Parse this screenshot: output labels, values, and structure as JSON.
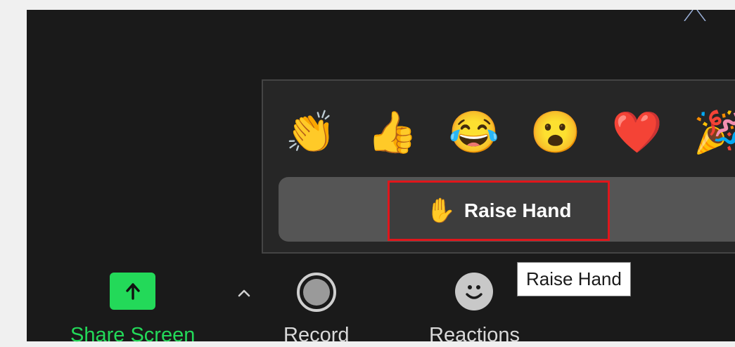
{
  "reactions_panel": {
    "emojis": [
      {
        "name": "clapping-hands",
        "glyph": "👏"
      },
      {
        "name": "thumbs-up",
        "glyph": "👍"
      },
      {
        "name": "tears-of-joy",
        "glyph": "😂"
      },
      {
        "name": "open-mouth",
        "glyph": "😮"
      },
      {
        "name": "red-heart",
        "glyph": "❤️"
      },
      {
        "name": "party-popper",
        "glyph": "🎉"
      }
    ],
    "raise_hand": {
      "icon": "raised-hand-icon",
      "glyph": "✋",
      "label": "Raise Hand"
    }
  },
  "tooltip": {
    "text": "Raise Hand"
  },
  "toolbar": {
    "share_screen": {
      "label": "Share Screen",
      "icon": "share-screen-arrow-up-icon"
    },
    "caret": {
      "icon": "chevron-up-icon"
    },
    "record": {
      "label": "Record",
      "icon": "record-icon"
    },
    "reactions": {
      "label": "Reactions",
      "icon": "smiley-face-icon"
    }
  },
  "colors": {
    "background": "#1a1a1a",
    "share_green": "#23d959",
    "highlight_red": "#e0161b",
    "raise_bar": "#555555"
  }
}
